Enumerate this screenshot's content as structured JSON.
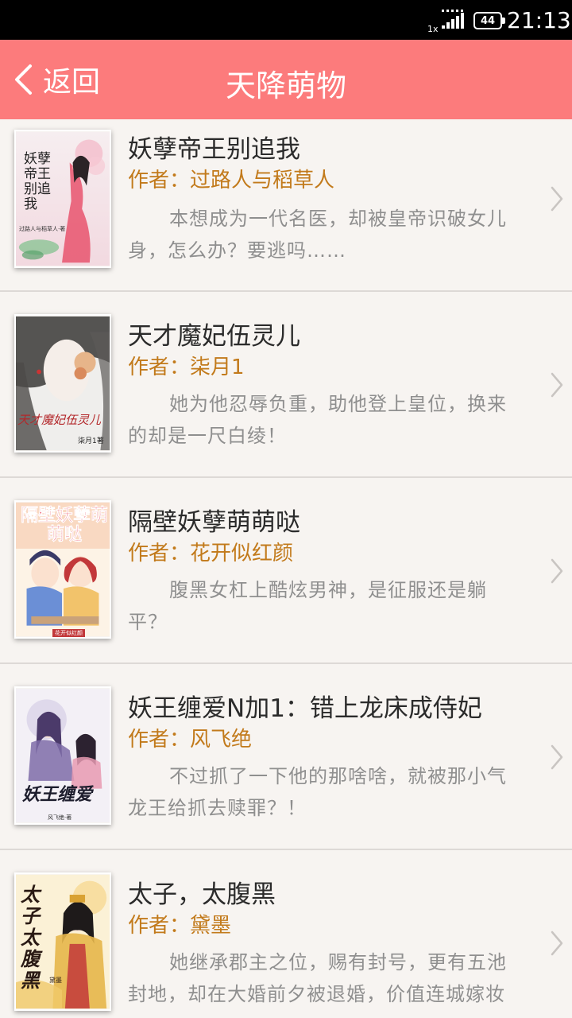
{
  "status_bar": {
    "network_label": "1x",
    "battery": "44",
    "time": "21:13"
  },
  "header": {
    "back_label": "返回",
    "title": "天降萌物"
  },
  "books": [
    {
      "title": "妖孽帝王别追我",
      "author": "作者：过路人与稻草人",
      "description": "本想成为一代名医，却被皇帝识破女儿身，怎么办？要逃吗……",
      "cover_text": "妖孽帝王别追我",
      "cover_byline": "过路人与稻草人·著"
    },
    {
      "title": "天才魔妃伍灵儿",
      "author": "作者：柒月1",
      "description": "她为他忍辱负重，助他登上皇位，换来的却是一尺白绫！",
      "cover_text": "天才魔妃伍灵儿",
      "cover_byline": "柒月1著"
    },
    {
      "title": "隔壁妖孽萌萌哒",
      "author": "作者：花开似红颜",
      "description": "腹黑女杠上酷炫男神，是征服还是躺平？",
      "cover_text": "隔壁妖孽萌萌哒",
      "cover_byline": "花开似红颜"
    },
    {
      "title": "妖王缠爱N加1：错上龙床成侍妃",
      "author": "作者：风飞绝",
      "description": "不过抓了一下他的那啥啥，就被那小气龙王给抓去赎罪？！",
      "cover_text": "妖王缠爱",
      "cover_byline": "风飞绝·著"
    },
    {
      "title": "太子，太腹黑",
      "author": "作者：黛墨",
      "description": "她继承郡主之位，赐有封号，更有五池封地，却在大婚前夕被退婚，价值连城嫁妆",
      "cover_text": "太子太腹黑",
      "cover_byline": "黛墨"
    }
  ],
  "colors": {
    "header_bg": "#fc7b7c",
    "author": "#c27a1b",
    "page_bg": "#f7f4f1"
  }
}
